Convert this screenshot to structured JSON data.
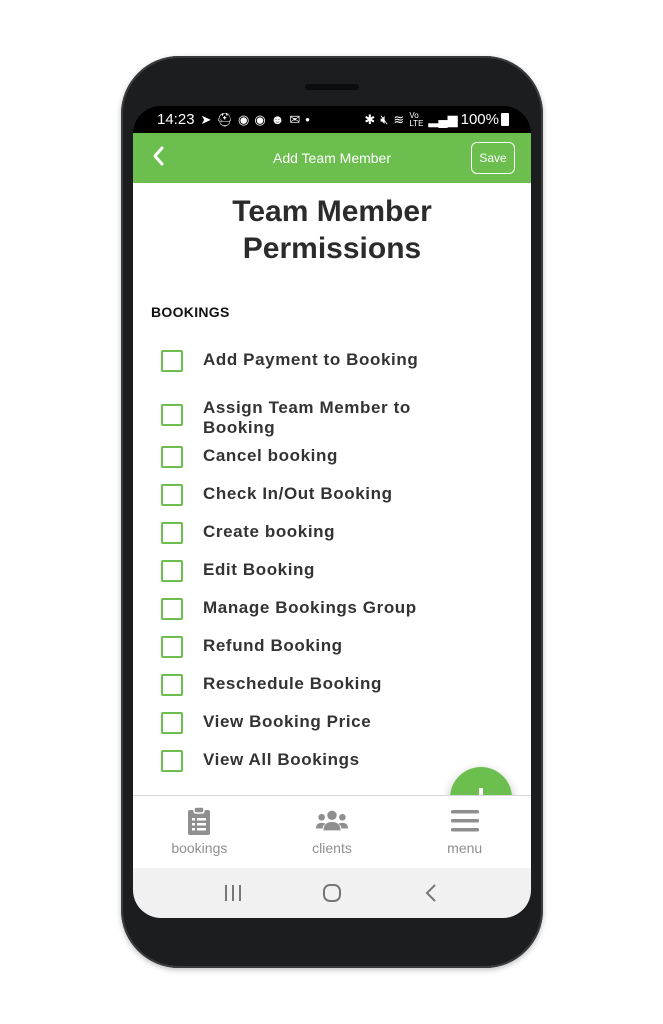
{
  "status_bar": {
    "time": "14:23",
    "battery": "100%"
  },
  "app_bar": {
    "title": "Add Team Member",
    "save_label": "Save"
  },
  "page": {
    "title_line1": "Team Member",
    "title_line2": "Permissions",
    "section": "BOOKINGS"
  },
  "permissions": [
    {
      "label": "Add Payment to Booking",
      "checked": false
    },
    {
      "label": "Assign Team Member to Booking",
      "checked": false
    },
    {
      "label": "Cancel booking",
      "checked": false
    },
    {
      "label": "Check In/Out Booking",
      "checked": false
    },
    {
      "label": "Create booking",
      "checked": false
    },
    {
      "label": "Edit Booking",
      "checked": false
    },
    {
      "label": "Manage Bookings Group",
      "checked": false
    },
    {
      "label": "Refund Booking",
      "checked": false
    },
    {
      "label": "Reschedule Booking",
      "checked": false
    },
    {
      "label": "View Booking Price",
      "checked": false
    },
    {
      "label": "View All Bookings",
      "checked": false
    }
  ],
  "fab": {
    "icon": "plus-icon"
  },
  "bottom_nav": {
    "items": [
      {
        "label": "bookings",
        "icon": "clipboard-icon"
      },
      {
        "label": "clients",
        "icon": "users-icon"
      },
      {
        "label": "menu",
        "icon": "hamburger-menu-icon"
      }
    ]
  },
  "colors": {
    "accent": "#6cbf4e",
    "text": "#333333",
    "nav_gray": "#8f8f8f"
  }
}
